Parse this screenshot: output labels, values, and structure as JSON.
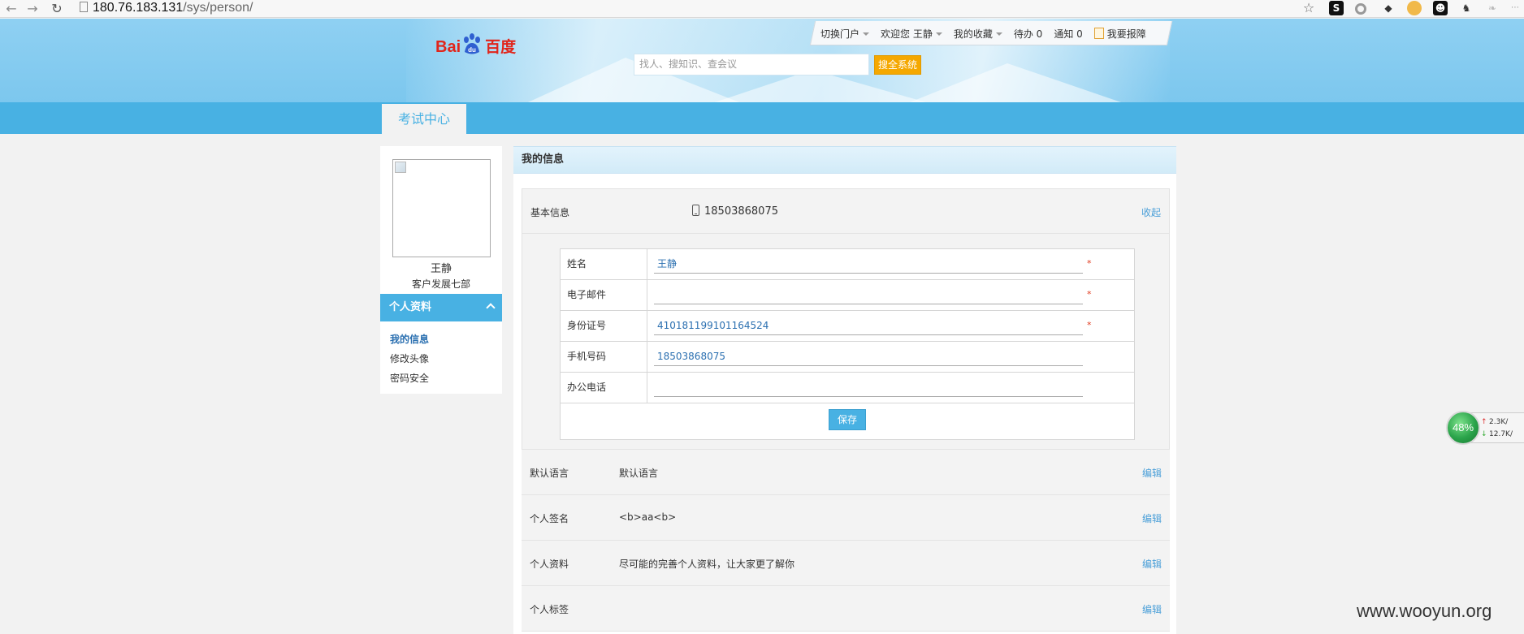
{
  "browser": {
    "url_host": "180.76.183.131",
    "url_path": "/sys/person/"
  },
  "header": {
    "logo_text": "Bai",
    "logo_du": "du",
    "logo_cn": "百度",
    "search_placeholder": "找人、搜知识、查会议",
    "search_button": "搜全系统",
    "topnav": {
      "switch_portal": "切换门户",
      "welcome": "欢迎您 王静",
      "favorites": "我的收藏",
      "todo": "待办 0",
      "notice": "通知 0",
      "report": "我要报障"
    }
  },
  "nav": {
    "tab_exam": "考试中心"
  },
  "sidebar": {
    "user_name": "王静",
    "user_dept": "客户发展七部",
    "section_title": "个人资料",
    "links": [
      "我的信息",
      "修改头像",
      "密码安全"
    ]
  },
  "main": {
    "title": "我的信息",
    "basic": {
      "label": "基本信息",
      "phone": "18503868075",
      "collapse": "收起"
    },
    "form": {
      "rows": [
        {
          "label": "姓名",
          "value": "王静",
          "required": "*"
        },
        {
          "label": "电子邮件",
          "value": "",
          "required": "*"
        },
        {
          "label": "身份证号",
          "value": "410181199101164524",
          "required": "*"
        },
        {
          "label": "手机号码",
          "value": "18503868075",
          "required": ""
        },
        {
          "label": "办公电话",
          "value": "",
          "required": ""
        }
      ],
      "save": "保存"
    },
    "info_rows": [
      {
        "label": "默认语言",
        "value": "默认语言",
        "edit": "编辑"
      },
      {
        "label": "个人签名",
        "value": "<b>aa<b>",
        "edit": "编辑"
      },
      {
        "label": "个人资料",
        "value": "尽可能的完善个人资料，让大家更了解你",
        "edit": "编辑"
      },
      {
        "label": "个人标签",
        "value": "",
        "edit": "编辑"
      }
    ]
  },
  "speed_widget": {
    "percent": "48%",
    "up": "2.3K/",
    "down": "12.7K/"
  },
  "watermark": "www.wooyun.org"
}
